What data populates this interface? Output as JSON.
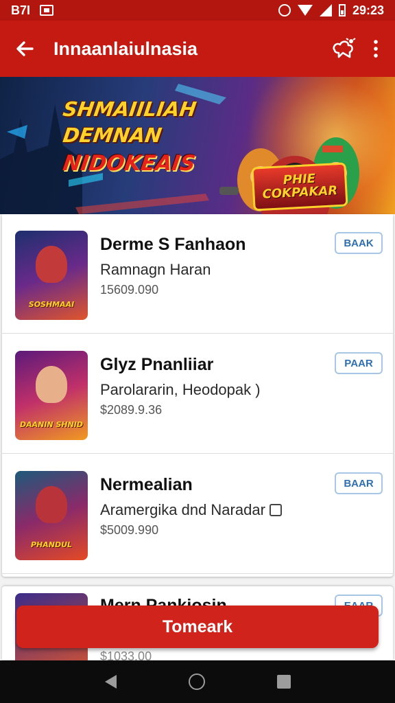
{
  "status_bar": {
    "left_text": "B7I",
    "time": "29:23"
  },
  "app_bar": {
    "title": "Innaanlaiulnasia",
    "back_icon": "arrow-left-icon",
    "share_icon": "share-icon",
    "menu_icon": "more-vert-icon"
  },
  "banner": {
    "line1": "SHMAIILIAH",
    "line2": "DEMNAN",
    "line3": "NIDOKEAIS",
    "badge_line1": "PHIE",
    "badge_line2": "COKPAKAR"
  },
  "list": {
    "items": [
      {
        "name": "Derme S Fanhaon",
        "subtitle": "Ramnagn Haran",
        "price": "15609.090",
        "button": "BAAK",
        "thumb_title": "SOSHMAAI",
        "thumb_colors": [
          "#1d2f6e",
          "#e0562a"
        ]
      },
      {
        "name": "Glyz Pnanliiar",
        "subtitle": "Parolararin, Heodopak )",
        "price": "$2089.9.36",
        "button": "PAAR",
        "thumb_title": "DAANIN SHNID",
        "thumb_colors": [
          "#5b1a7a",
          "#f09a21"
        ]
      },
      {
        "name": "Nermealian",
        "subtitle": "Aramergika dnd Naradar",
        "price": "$5009.990",
        "button": "BAAR",
        "thumb_title": "PHANDUL",
        "thumb_colors": [
          "#1d5a7a",
          "#e44a24"
        ]
      },
      {
        "name": "Mern Pankiosin",
        "subtitle": "",
        "price": "$1033.00",
        "button": "EAAR",
        "thumb_title": "",
        "thumb_colors": [
          "#3b2c8a",
          "#e0562a"
        ]
      }
    ]
  },
  "cta": {
    "label": "Tomeark"
  }
}
